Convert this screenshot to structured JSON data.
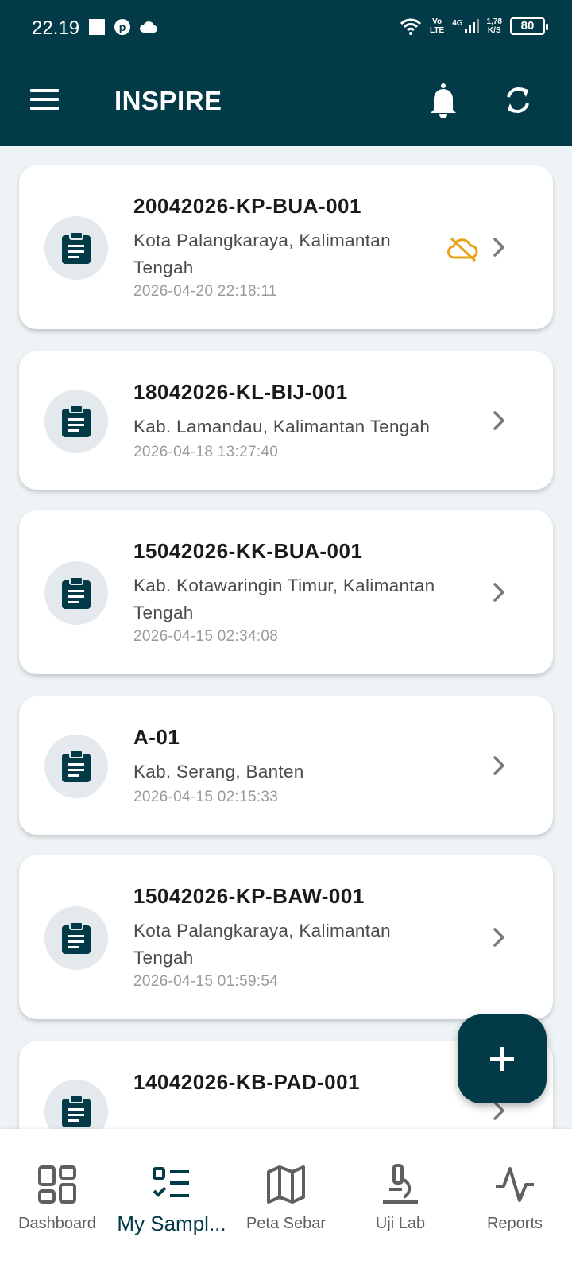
{
  "status_bar": {
    "time": "22.19",
    "volte_top": "Vo",
    "volte_bottom": "LTE",
    "network": "4G",
    "speed_top": "1,78",
    "speed_bottom": "K/S",
    "battery": "80"
  },
  "app_bar": {
    "title": "INSPIRE",
    "menu_icon": "hamburger-menu-icon",
    "bell_icon": "bell-icon",
    "sync_icon": "sync-icon"
  },
  "samples": [
    {
      "id": "20042026-KP-BUA-001",
      "location": "Kota Palangkaraya, Kalimantan Tengah",
      "date": "2026-04-20 22:18:11",
      "unsynced": true
    },
    {
      "id": "18042026-KL-BIJ-001",
      "location": "Kab. Lamandau, Kalimantan Tengah",
      "date": "2026-04-18 13:27:40",
      "unsynced": false
    },
    {
      "id": "15042026-KK-BUA-001",
      "location": "Kab. Kotawaringin Timur, Kalimantan Tengah",
      "date": "2026-04-15 02:34:08",
      "unsynced": false
    },
    {
      "id": "A-01",
      "location": "Kab. Serang, Banten",
      "date": "2026-04-15 02:15:33",
      "unsynced": false
    },
    {
      "id": "15042026-KP-BAW-001",
      "location": "Kota Palangkaraya, Kalimantan Tengah",
      "date": "2026-04-15 01:59:54",
      "unsynced": false
    },
    {
      "id": "14042026-KB-PAD-001",
      "location": "",
      "date": "",
      "unsynced": false
    }
  ],
  "colors": {
    "primary": "#023a47",
    "unsynced_warning": "#e8a317",
    "background": "#eef3f5"
  },
  "fab": {
    "icon": "plus-icon"
  },
  "bottom_nav": [
    {
      "label": "Dashboard",
      "icon": "dashboard-grid-icon",
      "active": false
    },
    {
      "label": "My Sampl...",
      "icon": "checklist-icon",
      "active": true
    },
    {
      "label": "Peta Sebar",
      "icon": "map-icon",
      "active": false
    },
    {
      "label": "Uji Lab",
      "icon": "microscope-icon",
      "active": false
    },
    {
      "label": "Reports",
      "icon": "activity-pulse-icon",
      "active": false
    }
  ]
}
